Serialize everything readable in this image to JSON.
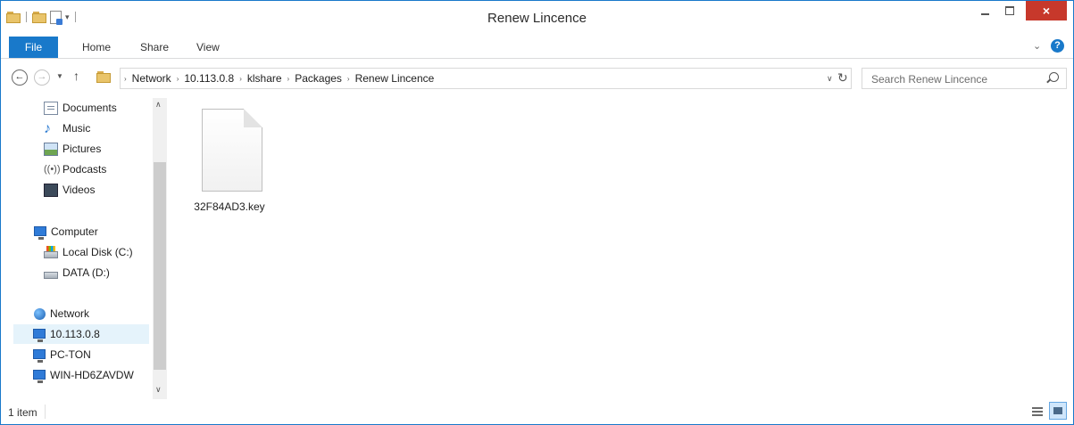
{
  "window": {
    "title": "Renew Lincence",
    "accent_color": "#1979ca",
    "close_color": "#c7382b"
  },
  "window_controls": {
    "minimize_icon": "minimize-icon",
    "maximize_icon": "maximize-icon",
    "close_glyph": "×"
  },
  "quick_access": {
    "icons": [
      "folder-icon",
      "properties-icon",
      "new-folder-icon",
      "customize-dropdown-icon"
    ],
    "dropdown_glyph": "▾"
  },
  "ribbon": {
    "tabs": [
      "File",
      "Home",
      "Share",
      "View"
    ],
    "expand_glyph": "⌄",
    "help_glyph": "?"
  },
  "navigation": {
    "back_glyph": "←",
    "forward_glyph": "→",
    "recent_glyph": "▼",
    "up_glyph": "↑"
  },
  "address": {
    "breadcrumbs": [
      "Network",
      "10.113.0.8",
      "klshare",
      "Packages",
      "Renew Lincence"
    ],
    "separator_glyph": "›",
    "dropdown_glyph": "∨",
    "refresh_glyph": "↻"
  },
  "search": {
    "placeholder": "Search Renew Lincence"
  },
  "nav_pane": {
    "items": [
      {
        "label": "Documents",
        "icon": "documents-icon"
      },
      {
        "label": "Music",
        "icon": "music-icon"
      },
      {
        "label": "Pictures",
        "icon": "pictures-icon"
      },
      {
        "label": "Podcasts",
        "icon": "podcasts-icon"
      },
      {
        "label": "Videos",
        "icon": "videos-icon"
      },
      {
        "label": "Computer",
        "icon": "computer-icon"
      },
      {
        "label": "Local Disk (C:)",
        "icon": "local-disk-icon"
      },
      {
        "label": "DATA (D:)",
        "icon": "drive-icon"
      },
      {
        "label": "Network",
        "icon": "network-icon"
      },
      {
        "label": "10.113.0.8",
        "icon": "computer-icon",
        "selected": true
      },
      {
        "label": "PC-TON",
        "icon": "computer-icon"
      },
      {
        "label": "WIN-HD6ZAVDW",
        "icon": "computer-icon"
      }
    ],
    "scroll_up_glyph": "∧",
    "scroll_down_glyph": "∨"
  },
  "content": {
    "files": [
      {
        "name": "32F84AD3.key",
        "icon": "file-icon"
      }
    ]
  },
  "status": {
    "item_count": "1 item"
  },
  "view_buttons": [
    "details-view-icon",
    "large-icons-view-icon"
  ]
}
